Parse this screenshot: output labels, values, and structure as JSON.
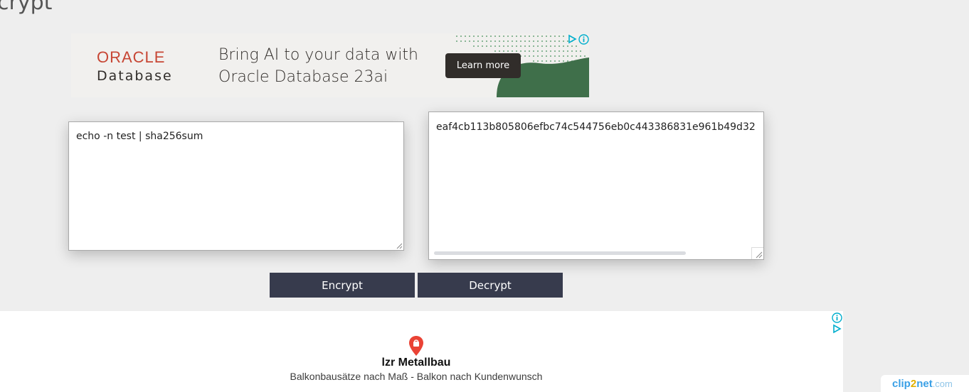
{
  "page": {
    "heading": "crypt"
  },
  "ad_top": {
    "brand_line1": "ORACLE",
    "brand_line2": "Database",
    "tagline_line1": "Bring AI to your data with",
    "tagline_line2": "Oracle Database 23ai",
    "cta_label": "Learn more",
    "icons": [
      "adchoices-play-icon",
      "adchoices-info-icon"
    ],
    "colors": {
      "brand_red": "#c74634",
      "dark": "#312d2a",
      "hill_green": "#3f6f4a"
    }
  },
  "input": {
    "value": "echo -n test | sha256sum"
  },
  "output": {
    "value": "eaf4cb113b805806efbc74c544756eb0c443386831e961b49d32"
  },
  "buttons": {
    "encrypt_label": "Encrypt",
    "decrypt_label": "Decrypt",
    "color": "#373b4d"
  },
  "ad_bottom": {
    "business_name": "lzr Metallbau",
    "description": "Balkonbausätze nach Maß - Balkon nach Kundenwunsch",
    "icons": [
      "map-pin-icon",
      "adchoices-info-icon",
      "adchoices-play-icon"
    ]
  },
  "watermark": {
    "part1": "clip",
    "part2": "2",
    "part3": "net",
    "part4": ".com"
  }
}
